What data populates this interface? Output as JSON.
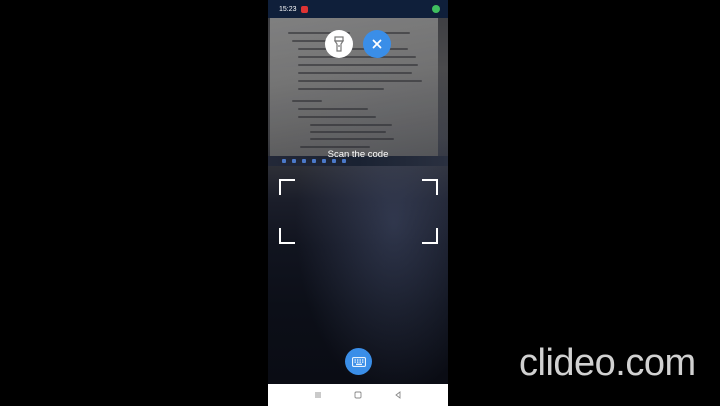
{
  "status_bar": {
    "time": "15:23",
    "recording_icon": "record-indicator-icon",
    "shield_icon": "security-shield-icon"
  },
  "toolbar": {
    "flashlight_icon": "flashlight-icon",
    "close_icon": "close-icon"
  },
  "scanner": {
    "instruction": "Scan the code"
  },
  "actions": {
    "keyboard_icon": "keyboard-icon"
  },
  "nav": {
    "recents_icon": "recents-icon",
    "home_icon": "home-icon",
    "back_icon": "back-icon"
  },
  "watermark": {
    "text": "clideo.com"
  },
  "colors": {
    "accent": "#3a8ee8",
    "status_bar": "#0f1f3a",
    "background": "#000000"
  }
}
